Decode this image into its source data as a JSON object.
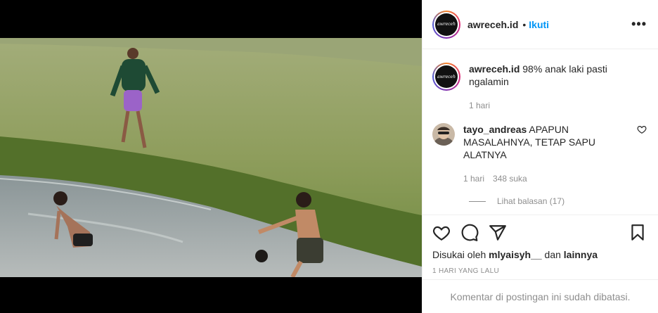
{
  "post": {
    "username": "awreceh.id",
    "follow_label": "Ikuti",
    "separator": "•",
    "more_label": "•••",
    "avatar_text": "awreceh.id"
  },
  "caption": {
    "username": "awreceh.id",
    "text": "98% anak laki pasti ngalamin",
    "time": "1 hari"
  },
  "comments": [
    {
      "username": "tayo_andreas",
      "text": "APAPUN MASALAHNYA, TETAP SAPU ALATNYA",
      "time": "1 hari",
      "likes": "348 suka",
      "replies_label": "Lihat balasan (17)"
    }
  ],
  "likes": {
    "prefix": "Disukai oleh",
    "user": "mlyaisyh__",
    "joiner": "dan",
    "others": "lainnya"
  },
  "timestamp": "1 hari yang lalu",
  "comments_limited": "Komentar di postingan ini sudah dibatasi.",
  "icons": {
    "like": "heart-icon",
    "comment": "comment-icon",
    "share": "share-icon",
    "save": "bookmark-icon",
    "comment_like": "heart-icon"
  },
  "colors": {
    "accent": "#0095f6",
    "muted": "#8e8e8e",
    "text": "#262626"
  }
}
